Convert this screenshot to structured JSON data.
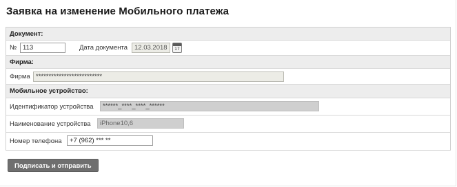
{
  "page": {
    "title": "Заявка на изменение Мобильного платежа"
  },
  "document": {
    "section_title": "Документ:",
    "number_label": "№",
    "number_value": "113",
    "date_label": "Дата документа",
    "date_value": "12.03.2018",
    "calendar_day": "17"
  },
  "firm": {
    "section_title": "Фирма:",
    "label": "Фирма",
    "value": "**************************"
  },
  "device": {
    "section_title": "Мобильное устройство:",
    "id_label": "Идентификатор устройства",
    "id_value": "******_****_****_******",
    "name_label": "Наименование устройства",
    "name_value": "iPhone10,6",
    "phone_label": "Номер телефона",
    "phone_value": "+7 (962) *** **"
  },
  "actions": {
    "submit_label": "Подписать и отправить"
  }
}
